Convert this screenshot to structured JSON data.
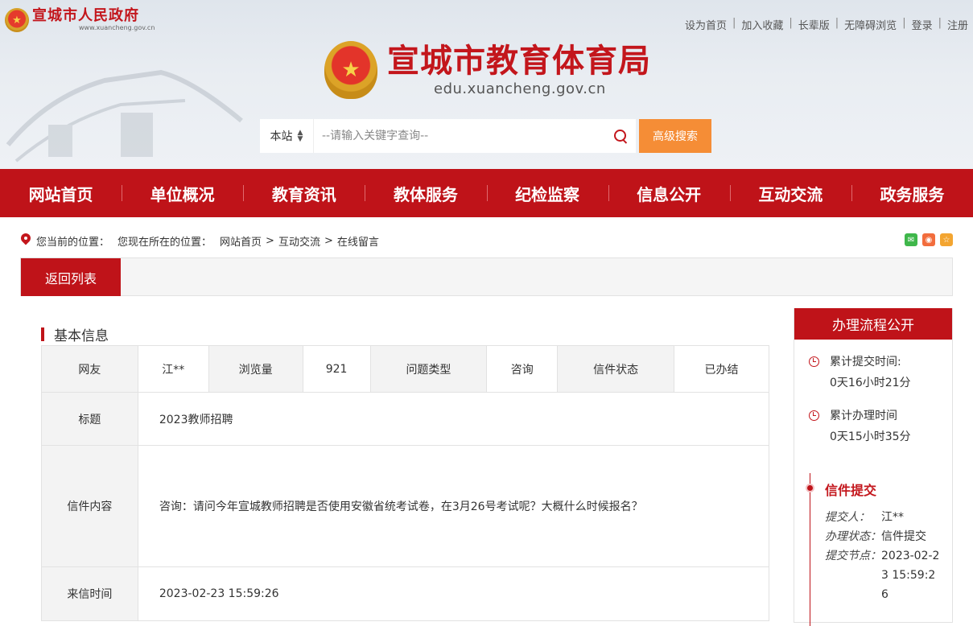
{
  "top": {
    "gov_name": "宣城市人民政府",
    "gov_url": "www.xuancheng.gov.cn",
    "links": [
      "设为首页",
      "加入收藏",
      "长辈版",
      "无障碍浏览",
      "登录",
      "注册"
    ]
  },
  "site": {
    "name": "宣城市教育体育局",
    "url": "edu.xuancheng.gov.cn"
  },
  "search": {
    "scope": "本站",
    "placeholder": "--请输入关键字查询--",
    "advanced_label": "高级搜索"
  },
  "nav": [
    "网站首页",
    "单位概况",
    "教育资讯",
    "教体服务",
    "纪检监察",
    "信息公开",
    "互动交流",
    "政务服务"
  ],
  "breadcrumb": {
    "prefix": "您当前的位置：",
    "current_label": "您现在所在的位置：",
    "items": [
      "网站首页",
      "互动交流",
      "在线留言"
    ]
  },
  "tab": {
    "back_label": "返回列表"
  },
  "basic": {
    "title": "基本信息",
    "row1": {
      "user_label": "网友",
      "user_value": "江**",
      "views_label": "浏览量",
      "views_value": "921",
      "type_label": "问题类型",
      "type_value": "咨询",
      "status_label": "信件状态",
      "status_value": "已办结"
    },
    "subject_label": "标题",
    "subject_value": "2023教师招聘",
    "content_label": "信件内容",
    "content_value": "咨询：请问今年宣城教师招聘是否使用安徽省统考试卷，在3月26号考试呢？大概什么时候报名？",
    "time_label": "来信时间",
    "time_value": "2023-02-23 15:59:26"
  },
  "process": {
    "title": "办理流程公开",
    "submit_elapsed_label": "累计提交时间:",
    "submit_elapsed_value": "0天16小时21分",
    "handle_elapsed_label": "累计办理时间",
    "handle_elapsed_value": "0天15小时35分",
    "step_title": "信件提交",
    "submitter_label": "提交人：",
    "submitter_value": "江**",
    "state_label": "办理状态：",
    "state_value": "信件提交",
    "node_label": "提交节点：",
    "node_value": "2023-02-23 15:59:26"
  },
  "colors": {
    "brand_red": "#bf1319",
    "search_orange": "#f58d36"
  }
}
